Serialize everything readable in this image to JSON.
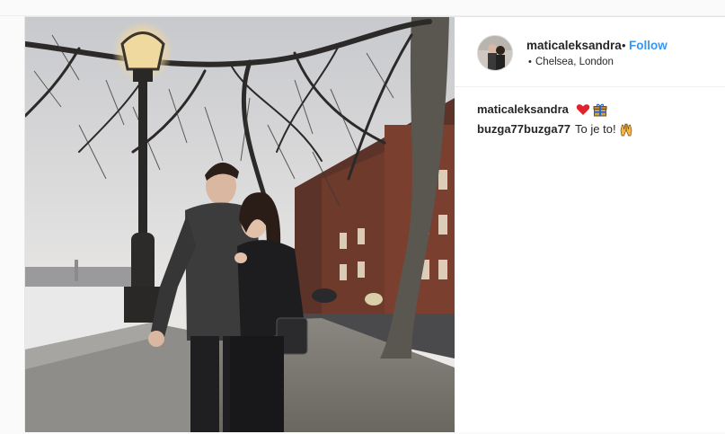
{
  "post": {
    "username": "maticaleksandra",
    "separator": "•",
    "follow_label": "Follow",
    "location_prefix": "•",
    "location": "Chelsea, London"
  },
  "comments": [
    {
      "user": "maticaleksandra",
      "text": "",
      "emojis": [
        "red-heart-icon",
        "gift-icon"
      ]
    },
    {
      "user": "buzga77buzga77",
      "text": "To je to!",
      "emojis": [
        "raising-hands-icon"
      ]
    }
  ],
  "colors": {
    "follow": "#3897f0",
    "text": "#262626",
    "heart": "#e0222c"
  }
}
